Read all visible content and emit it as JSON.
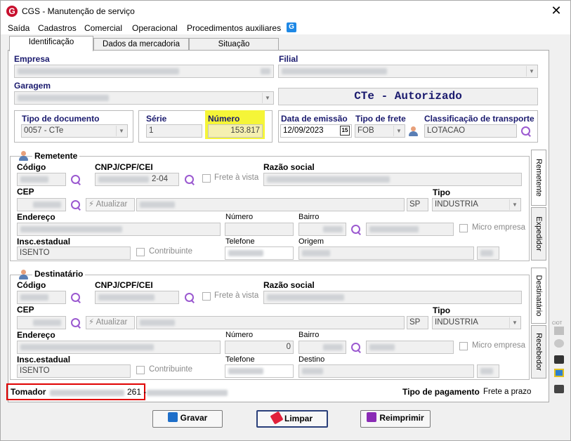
{
  "window": {
    "title": "CGS - Manutenção de serviço",
    "app_icon": "G",
    "close": "✕"
  },
  "menu": [
    "Saída",
    "Cadastros",
    "Comercial",
    "Operacional",
    "Procedimentos auxiliares"
  ],
  "menu_icon": "G",
  "tabs": [
    "Identificação",
    "Dados da mercadoria",
    "Situação"
  ],
  "empresa": {
    "label": "Empresa"
  },
  "filial": {
    "label": "Filial"
  },
  "garagem": {
    "label": "Garagem"
  },
  "status": "CTe - Autorizado",
  "tipo_documento": {
    "label": "Tipo de documento",
    "value": "0057 - CTe"
  },
  "serie": {
    "label": "Série",
    "value": "1"
  },
  "numero": {
    "label": "Número",
    "value": "153.817"
  },
  "data_emissao": {
    "label": "Data de emissão",
    "value": "12/09/2023",
    "cal": "15"
  },
  "tipo_frete": {
    "label": "Tipo de frete",
    "value": "FOB"
  },
  "classificacao": {
    "label": "Classificação de transporte",
    "value": "LOTACAO"
  },
  "remetente": {
    "title": "Remetente",
    "codigo": "Código",
    "cnpj_label": "CNPJ/CPF/CEI",
    "cnpj_suffix": "2-04",
    "frete_vista": "Frete à vista",
    "razao_social": "Razão social",
    "cep": "CEP",
    "atualizar": "Atualizar",
    "uf": "SP",
    "tipo_label": "Tipo",
    "tipo_value": "INDUSTRIA",
    "endereco": "Endereço",
    "numero": "Número",
    "bairro": "Bairro",
    "micro": "Micro empresa",
    "insc_label": "Insc.estadual",
    "insc_value": "ISENTO",
    "contribuinte": "Contribuinte",
    "telefone": "Telefone",
    "origem": "Origem"
  },
  "destinatario": {
    "title": "Destinatário",
    "codigo": "Código",
    "cnpj_label": "CNPJ/CPF/CEI",
    "frete_vista": "Frete à vista",
    "razao_social": "Razão social",
    "cep": "CEP",
    "atualizar": "Atualizar",
    "uf": "SP",
    "tipo_label": "Tipo",
    "tipo_value": "INDUSTRIA",
    "endereco": "Endereço",
    "numero": "Número",
    "numero_value": "0",
    "bairro": "Bairro",
    "micro": "Micro empresa",
    "insc_label": "Insc.estadual",
    "insc_value": "ISENTO",
    "contribuinte": "Contribuinte",
    "telefone": "Telefone",
    "destino": "Destino"
  },
  "side_tabs": [
    "Remetente",
    "Expedidor",
    "Destinatário",
    "Recebedor"
  ],
  "tomador": {
    "label": "Tomador",
    "value": "261 -"
  },
  "pagamento": {
    "label": "Tipo de pagamento",
    "value": "Frete a prazo"
  },
  "buttons": {
    "gravar": "Gravar",
    "limpar": "Limpar",
    "reimprimir": "Reimprimir"
  },
  "side_label": "CIOT",
  "colors": {
    "highlight": "#f5f538",
    "red_box": "#e00000",
    "navy": "#1a1a6e",
    "accent_purple": "#9b59d0"
  }
}
